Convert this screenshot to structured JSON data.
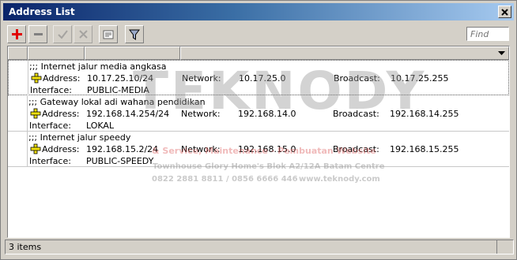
{
  "window": {
    "title": "Address List"
  },
  "toolbar": {
    "find_placeholder": "Find",
    "buttons": [
      {
        "name": "add",
        "icon": "plus-icon"
      },
      {
        "name": "remove",
        "icon": "minus-icon"
      },
      {
        "name": "enable",
        "icon": "check-icon"
      },
      {
        "name": "disable",
        "icon": "x-icon"
      },
      {
        "name": "comment",
        "icon": "comment-icon"
      },
      {
        "name": "filter",
        "icon": "filter-icon"
      }
    ]
  },
  "labels": {
    "address": "Address:",
    "network": "Network:",
    "broadcast": "Broadcast:",
    "interface": "Interface:"
  },
  "rows": [
    {
      "comment": ";;; Internet jalur media angkasa",
      "address": "10.17.25.10/24",
      "network": "10.17.25.0",
      "broadcast": "10.17.25.255",
      "interface": "PUBLIC-MEDIA"
    },
    {
      "comment": ";;; Gateway lokal adi wahana pendidikan",
      "address": "192.168.14.254/24",
      "network": "192.168.14.0",
      "broadcast": "192.168.14.255",
      "interface": "LOKAL"
    },
    {
      "comment": ";;; Internet jalur speedy",
      "address": "192.168.15.2/24",
      "network": "192.168.15.0",
      "broadcast": "192.168.15.255",
      "interface": "PUBLIC-SPEEDY"
    }
  ],
  "watermark": {
    "logo": "TEKNODY",
    "services": "& Service, Maintenance - Pembuatan Website",
    "address": "Townhouse Glory Home's Blok A2/12A Batam Centre",
    "phone": "0822 2881 8811 / 0856 6666 446",
    "web": "www.teknody.com"
  },
  "status": {
    "count": "3 items"
  },
  "colors": {
    "title_start": "#0a246a",
    "title_end": "#a6caf0",
    "add_red": "#e00000",
    "watermark": "#c8c8c8"
  }
}
